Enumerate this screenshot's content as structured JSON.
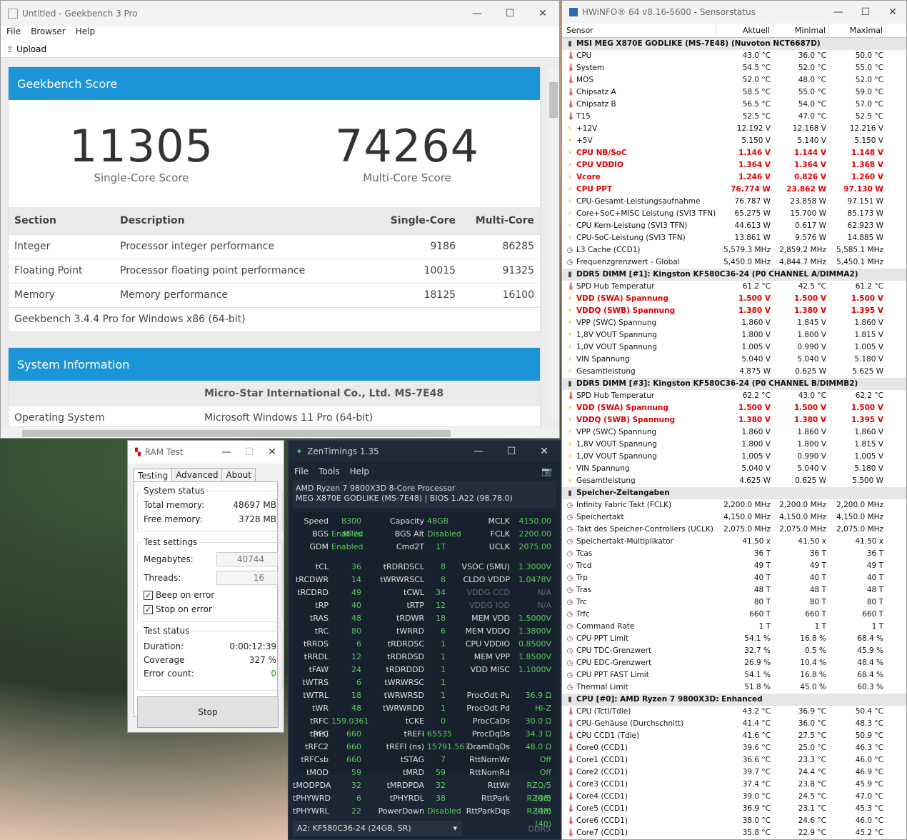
{
  "geekbench": {
    "title": "Untitled - Geekbench 3 Pro",
    "menu": [
      "File",
      "Browser",
      "Help"
    ],
    "upload_label": "Upload",
    "score_header": "Geekbench Score",
    "single_score": "11305",
    "single_label": "Single-Core Score",
    "multi_score": "74264",
    "multi_label": "Multi-Core Score",
    "table_headers": [
      "Section",
      "Description",
      "Single-Core",
      "Multi-Core"
    ],
    "rows": [
      [
        "Integer",
        "Processor integer performance",
        "9186",
        "86285"
      ],
      [
        "Floating Point",
        "Processor floating point performance",
        "10015",
        "91325"
      ],
      [
        "Memory",
        "Memory performance",
        "18125",
        "16100"
      ]
    ],
    "version": "Geekbench 3.4.4 Pro for Windows x86 (64-bit)",
    "sysinfo_header": "System Information",
    "system_name": "Micro-Star International Co., Ltd. MS-7E48",
    "os_label": "Operating System",
    "os_value": "Microsoft Windows 11 Pro (64-bit)"
  },
  "ramtest": {
    "title": "RAM Test",
    "tabs": [
      "Testing",
      "Advanced",
      "About"
    ],
    "system_status": "System status",
    "total_label": "Total memory:",
    "total_value": "48697 MB",
    "free_label": "Free memory:",
    "free_value": "3728 MB",
    "settings": "Test settings",
    "mb_label": "Megabytes:",
    "mb_value": "40744",
    "threads_label": "Threads:",
    "threads_value": "16",
    "beep_label": "Beep on error",
    "stop_err_label": "Stop on error",
    "test_status": "Test status",
    "duration_label": "Duration:",
    "duration_value": "0:00:12:39",
    "coverage_label": "Coverage",
    "coverage_value": "327 %",
    "errors_label": "Error count:",
    "errors_value": "0",
    "stop_label": "Stop"
  },
  "zentimings": {
    "title": "ZenTimings 1.35",
    "menu": [
      "File",
      "Tools",
      "Help"
    ],
    "cpu": "AMD Ryzen 7 9800X3D 8-Core Processor",
    "board": "MEG X870E GODLIKE (MS-7E48) | BIOS 1.A22 (98.78.0)",
    "top": [
      [
        "Speed",
        "8300 MT/s",
        "Capacity",
        "48GB",
        "MCLK",
        "4150.00"
      ],
      [
        "BGS",
        "Enabled",
        "BGS Alt",
        "Disabled",
        "FCLK",
        "2200.00"
      ],
      [
        "GDM",
        "Enabled",
        "Cmd2T",
        "1T",
        "UCLK",
        "2075.00"
      ]
    ],
    "main": [
      [
        "tCL",
        "36",
        "tRDRDSCL",
        "8",
        "VSOC (SMU)",
        "1.3000V"
      ],
      [
        "tRCDWR",
        "14",
        "tWRWRSCL",
        "8",
        "CLDO VDDP",
        "1.0478V"
      ],
      [
        "tRCDRD",
        "49",
        "tCWL",
        "34",
        "VDDG CCD",
        "N/A"
      ],
      [
        "tRP",
        "40",
        "tRTP",
        "12",
        "VDDG IOD",
        "N/A"
      ],
      [
        "tRAS",
        "48",
        "tRDWR",
        "18",
        "MEM VDD",
        "1.5000V"
      ],
      [
        "tRC",
        "80",
        "tWRRD",
        "6",
        "MEM VDDQ",
        "1.3800V"
      ],
      [
        "tRRDS",
        "6",
        "tRDRDSC",
        "1",
        "CPU VDDIO",
        "0.8500V"
      ],
      [
        "tRRDL",
        "12",
        "tRDRDSD",
        "1",
        "MEM VPP",
        "1.8500V"
      ],
      [
        "tFAW",
        "24",
        "tRDRDDD",
        "1",
        "VDD MISC",
        "1.1000V"
      ],
      [
        "tWTRS",
        "6",
        "tWRWRSC",
        "1",
        "",
        ""
      ],
      [
        "tWTRL",
        "18",
        "tWRWRSD",
        "1",
        "ProcOdt Pu",
        "36.9 Ω"
      ],
      [
        "tWR",
        "48",
        "tWRWRDD",
        "1",
        "ProcOdt Pd",
        "Hi-Z"
      ],
      [
        "tRFC (ns)",
        "159.0361",
        "tCKE",
        "0",
        "ProcCaDs",
        "30.0 Ω"
      ],
      [
        "tRFC",
        "660",
        "tREFI",
        "65535",
        "ProcDqDs",
        "34.3 Ω"
      ],
      [
        "tRFC2",
        "660",
        "tREFI (ns)",
        "15791.567",
        "DramDqDs",
        "48.0 Ω"
      ],
      [
        "tRFCsb",
        "660",
        "tSTAG",
        "7",
        "RttNomWr",
        "Off"
      ],
      [
        "tMOD",
        "59",
        "tMRD",
        "59",
        "RttNomRd",
        "Off"
      ],
      [
        "tMODPDA",
        "32",
        "tMRDPDA",
        "32",
        "RttWr",
        "RZQ/5 (48)"
      ],
      [
        "tPHYWRD",
        "6",
        "tPHYRDL",
        "38",
        "RttPark",
        "RZQ/5 (48)"
      ],
      [
        "tPHYWRL",
        "22",
        "PowerDown",
        "Disabled",
        "RttParkDqs",
        "RZQ/6 (40)"
      ]
    ],
    "dimm_select": "A2: KF580C36-24 (24GB, SR)",
    "ddr": "DDR5"
  },
  "hwinfo": {
    "title": "HWiNFO® 64 v8.16-5600 - Sensorstatus",
    "headers": [
      "Sensor",
      "Aktuell",
      "Minimal",
      "Maximal"
    ],
    "rows": [
      [
        "g",
        "MSI MEG X870E GODLIKE (MS-7E48) (Nuvoton NCT6687D)",
        "",
        "",
        ""
      ],
      [
        "t",
        "CPU",
        "43.0 °C",
        "36.0 °C",
        "50.0 °C"
      ],
      [
        "t",
        "System",
        "54.5 °C",
        "52.0 °C",
        "55.0 °C"
      ],
      [
        "t",
        "MOS",
        "52.0 °C",
        "48.0 °C",
        "52.0 °C"
      ],
      [
        "t",
        "Chipsatz A",
        "58.5 °C",
        "55.0 °C",
        "59.0 °C"
      ],
      [
        "t",
        "Chipsatz B",
        "56.5 °C",
        "54.0 °C",
        "57.0 °C"
      ],
      [
        "t",
        "T15",
        "52.5 °C",
        "47.0 °C",
        "52.5 °C"
      ],
      [
        "v",
        "+12V",
        "12.192 V",
        "12.168 V",
        "12.216 V"
      ],
      [
        "v",
        "+5V",
        "5.150 V",
        "5.140 V",
        "5.150 V"
      ],
      [
        "vr",
        "CPU NB/SoC",
        "1.146 V",
        "1.144 V",
        "1.148 V"
      ],
      [
        "vr",
        "CPU VDDIO",
        "1.364 V",
        "1.364 V",
        "1.368 V"
      ],
      [
        "vr",
        "Vcore",
        "1.246 V",
        "0.826 V",
        "1.260 V"
      ],
      [
        "vr",
        "CPU PPT",
        "76.774 W",
        "23.862 W",
        "97.130 W"
      ],
      [
        "v",
        "CPU-Gesamt-Leistungsaufnahme",
        "76.787 W",
        "23.858 W",
        "97.151 W"
      ],
      [
        "v",
        "Core+SoC+MISC Leistung (SVI3 TFN)",
        "65.275 W",
        "15.700 W",
        "85.173 W"
      ],
      [
        "v",
        "CPU Kern-Leistung (SVI3 TFN)",
        "44.613 W",
        "0.617 W",
        "62.923 W"
      ],
      [
        "v",
        "CPU-SoC-Leistung (SVI3 TFN)",
        "13.861 W",
        "9.576 W",
        "14.885 W"
      ],
      [
        "c",
        "L3 Cache (CCD1)",
        "5,579.3 MHz",
        "2,859.2 MHz",
        "5,585.1 MHz"
      ],
      [
        "c",
        "Frequenzgrenzwert - Global",
        "5,450.0 MHz",
        "4,844.7 MHz",
        "5,450.1 MHz"
      ],
      [
        "g",
        "DDR5 DIMM [#1]: Kingston KF580C36-24 (P0 CHANNEL A/DIMMA2)",
        "",
        "",
        ""
      ],
      [
        "t",
        "SPD Hub Temperatur",
        "61.2 °C",
        "42.5 °C",
        "61.2 °C"
      ],
      [
        "vr",
        "VDD (SWA) Spannung",
        "1.500 V",
        "1.500 V",
        "1.500 V"
      ],
      [
        "vr",
        "VDDQ (SWB) Spannung",
        "1.380 V",
        "1.380 V",
        "1.395 V"
      ],
      [
        "v",
        "VPP (SWC) Spannung",
        "1.860 V",
        "1.845 V",
        "1.860 V"
      ],
      [
        "v",
        "1,8V VOUT Spannung",
        "1.800 V",
        "1.800 V",
        "1.815 V"
      ],
      [
        "v",
        "1,0V VOUT Spannung",
        "1.005 V",
        "0.990 V",
        "1.005 V"
      ],
      [
        "v",
        "VIN Spannung",
        "5.040 V",
        "5.040 V",
        "5.180 V"
      ],
      [
        "v",
        "Gesamtleistung",
        "4.875 W",
        "0.625 W",
        "5.625 W"
      ],
      [
        "g",
        "DDR5 DIMM [#3]: Kingston KF580C36-24 (P0 CHANNEL B/DIMMB2)",
        "",
        "",
        ""
      ],
      [
        "t",
        "SPD Hub Temperatur",
        "62.2 °C",
        "43.0 °C",
        "62.2 °C"
      ],
      [
        "vr",
        "VDD (SWA) Spannung",
        "1.500 V",
        "1.500 V",
        "1.500 V"
      ],
      [
        "vr",
        "VDDQ (SWB) Spannung",
        "1.380 V",
        "1.380 V",
        "1.395 V"
      ],
      [
        "v",
        "VPP (SWC) Spannung",
        "1.860 V",
        "1.860 V",
        "1.860 V"
      ],
      [
        "v",
        "1,8V VOUT Spannung",
        "1.800 V",
        "1.800 V",
        "1.815 V"
      ],
      [
        "v",
        "1,0V VOUT Spannung",
        "1.005 V",
        "0.990 V",
        "1.005 V"
      ],
      [
        "v",
        "VIN Spannung",
        "5.040 V",
        "5.040 V",
        "5.180 V"
      ],
      [
        "v",
        "Gesamtleistung",
        "4.625 W",
        "0.625 W",
        "5.500 W"
      ],
      [
        "g",
        "Speicher-Zeitangaben",
        "",
        "",
        ""
      ],
      [
        "c",
        "Infinity Fabric Takt (FCLK)",
        "2,200.0 MHz",
        "2,200.0 MHz",
        "2,200.0 MHz"
      ],
      [
        "c",
        "Speichertakt",
        "4,150.0 MHz",
        "4,150.0 MHz",
        "4,150.0 MHz"
      ],
      [
        "c",
        "Takt des Speicher-Controllers (UCLK)",
        "2,075.0 MHz",
        "2,075.0 MHz",
        "2,075.0 MHz"
      ],
      [
        "c",
        "Speichertakt-Multiplikator",
        "41.50 x",
        "41.50 x",
        "41.50 x"
      ],
      [
        "c",
        "Tcas",
        "36 T",
        "36 T",
        "36 T"
      ],
      [
        "c",
        "Trcd",
        "49 T",
        "49 T",
        "49 T"
      ],
      [
        "c",
        "Trp",
        "40 T",
        "40 T",
        "40 T"
      ],
      [
        "c",
        "Tras",
        "48 T",
        "48 T",
        "48 T"
      ],
      [
        "c",
        "Trc",
        "80 T",
        "80 T",
        "80 T"
      ],
      [
        "c",
        "Trfc",
        "660 T",
        "660 T",
        "660 T"
      ],
      [
        "c",
        "Command Rate",
        "1 T",
        "1 T",
        "1 T"
      ],
      [
        "c",
        "CPU PPT Limit",
        "54.1 %",
        "16.8 %",
        "68.4 %"
      ],
      [
        "c",
        "CPU TDC-Grenzwert",
        "32.7 %",
        "0.5 %",
        "45.9 %"
      ],
      [
        "c",
        "CPU EDC-Grenzwert",
        "26.9 %",
        "10.4 %",
        "48.4 %"
      ],
      [
        "c",
        "CPU PPT FAST Limit",
        "54.1 %",
        "16.8 %",
        "68.4 %"
      ],
      [
        "c",
        "Thermal Limit",
        "51.8 %",
        "45.0 %",
        "60.3 %"
      ],
      [
        "g",
        "CPU [#0]: AMD Ryzen 7 9800X3D: Enhanced",
        "",
        "",
        ""
      ],
      [
        "t",
        "CPU (Tctl/Tdie)",
        "43.2 °C",
        "36.9 °C",
        "50.4 °C"
      ],
      [
        "t",
        "CPU-Gehäuse (Durchschnitt)",
        "41.4 °C",
        "36.0 °C",
        "48.3 °C"
      ],
      [
        "t",
        "CPU CCD1 (Tdie)",
        "41.6 °C",
        "27.5 °C",
        "50.9 °C"
      ],
      [
        "t",
        "Core0 (CCD1)",
        "39.6 °C",
        "25.0 °C",
        "46.3 °C"
      ],
      [
        "t",
        "Core1 (CCD1)",
        "36.6 °C",
        "23.3 °C",
        "46.0 °C"
      ],
      [
        "t",
        "Core2 (CCD1)",
        "39.7 °C",
        "24.4 °C",
        "46.9 °C"
      ],
      [
        "t",
        "Core3 (CCD1)",
        "37.4 °C",
        "23.8 °C",
        "45.9 °C"
      ],
      [
        "t",
        "Core4 (CCD1)",
        "39.0 °C",
        "24.5 °C",
        "47.0 °C"
      ],
      [
        "t",
        "Core5 (CCD1)",
        "36.9 °C",
        "23.1 °C",
        "45.3 °C"
      ],
      [
        "t",
        "Core6 (CCD1)",
        "38.0 °C",
        "24.6 °C",
        "46.0 °C"
      ],
      [
        "t",
        "Core7 (CCD1)",
        "35.8 °C",
        "22.9 °C",
        "45.2 °C"
      ]
    ]
  }
}
